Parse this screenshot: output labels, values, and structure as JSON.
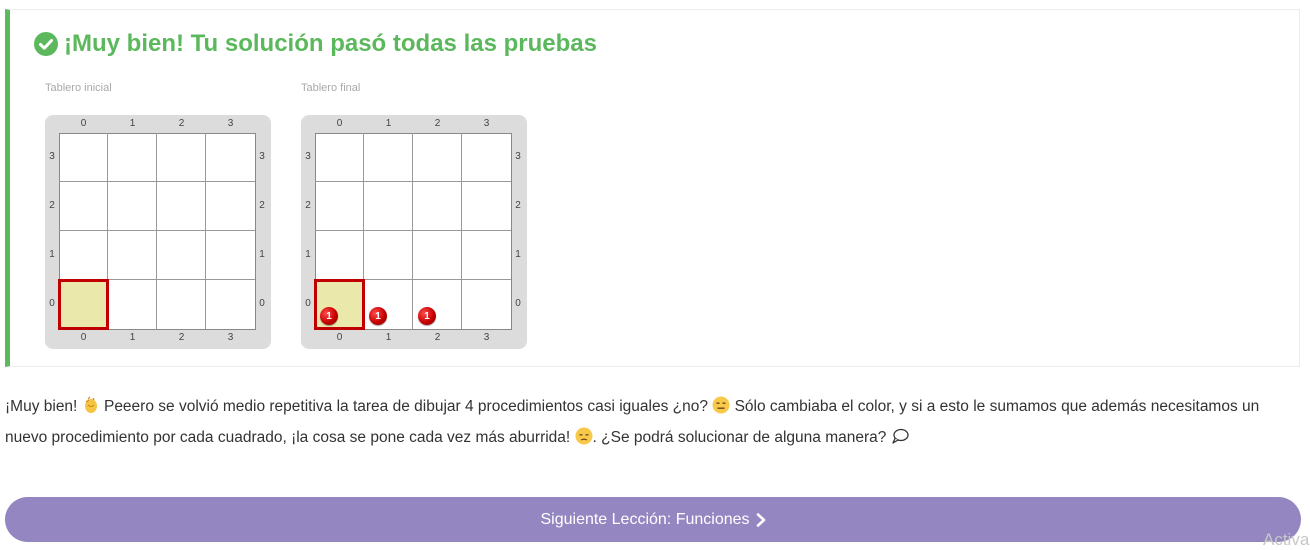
{
  "result": {
    "title": "¡Muy bien! Tu solución pasó todas las pruebas",
    "status_color": "#5cb85c"
  },
  "boards": [
    {
      "label": "Tablero inicial",
      "columns": [
        "0",
        "1",
        "2",
        "3"
      ],
      "rows": [
        "3",
        "2",
        "1",
        "0"
      ],
      "cursor": {
        "col": 0,
        "row": 0
      },
      "balls": []
    },
    {
      "label": "Tablero final",
      "columns": [
        "0",
        "1",
        "2",
        "3"
      ],
      "rows": [
        "3",
        "2",
        "1",
        "0"
      ],
      "cursor": {
        "col": 0,
        "row": 0
      },
      "balls": [
        {
          "col": 0,
          "row": 0,
          "count": "1",
          "color": "red"
        },
        {
          "col": 1,
          "row": 0,
          "count": "1",
          "color": "red"
        },
        {
          "col": 2,
          "row": 0,
          "count": "1",
          "color": "red"
        }
      ]
    }
  ],
  "message": {
    "part1": "¡Muy bien! ",
    "emoji1": "clapping-hands-icon",
    "part2": " Peeero se volvió medio repetitiva la tarea de dibujar 4 procedimientos casi iguales ¿no? ",
    "emoji2": "expressionless-face-icon",
    "part3": " Sólo cambiaba el color, y si a esto le sumamos que además necesitamos un nuevo procedimiento por cada cuadrado, ¡la cosa se pone cada vez más aburrida! ",
    "emoji3": "pensive-face-icon",
    "part4": ". ¿Se podrá solucionar de alguna manera? ",
    "emoji4": "speech-bubble-icon"
  },
  "next_button": {
    "label": "Siguiente Lección: Funciones",
    "icon": "chevron-right-icon",
    "color": "#9486c1"
  },
  "watermark": "Activa"
}
